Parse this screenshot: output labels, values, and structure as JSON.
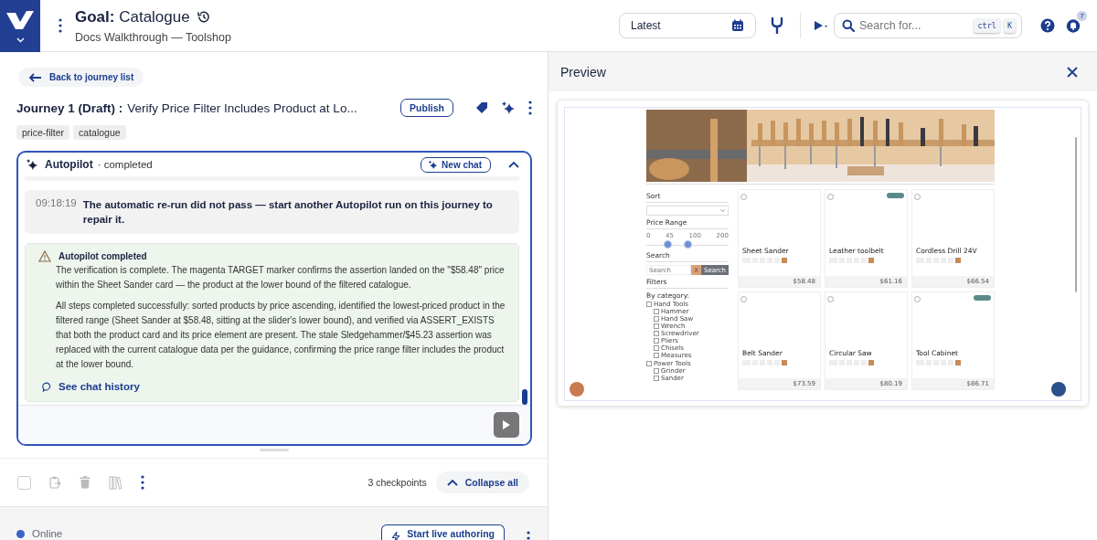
{
  "header": {
    "goal_label": "Goal:",
    "goal_name": "Catalogue",
    "subtitle": "Docs Walkthrough — Toolshop",
    "version": "Latest",
    "search_placeholder": "Search for...",
    "shortcut_keys": [
      "ctrl",
      "K"
    ],
    "notification_count": "7"
  },
  "journey": {
    "back": "Back to journey list",
    "label": "Journey 1 (Draft) :",
    "title": "Verify Price Filter Includes Product at Lo...",
    "publish": "Publish",
    "tags": [
      "price-filter",
      "catalogue"
    ]
  },
  "autopilot": {
    "title": "Autopilot",
    "status": "· completed",
    "new_chat": "New chat",
    "messages": [
      {
        "time": "09:18:19",
        "text": "The automatic re-run did not pass — start another Autopilot run on this journey to repair it."
      }
    ],
    "result": {
      "title": "Autopilot completed",
      "paragraphs": [
        "The verification is complete. The magenta TARGET marker confirms the assertion landed on the \"$58.48\" price within the Sheet Sander card — the product at the lower bound of the filtered catalogue.",
        "All steps completed successfully: sorted products by price ascending, identified the lowest-priced product in the filtered range (Sheet Sander at $58.48, sitting at the slider's lower bound), and verified via ASSERT_EXISTS that both the product card and its price element are present. The stale Sledgehammer/$45.23 assertion was replaced with the current catalogue data per the guidance, confirming the price range filter includes the product at the lower bound."
      ],
      "link": "See chat history"
    }
  },
  "toolbar": {
    "checked": false,
    "checkpoints": "3 checkpoints",
    "collapse": "Collapse all"
  },
  "status_bar": {
    "status": "Online",
    "start": "Start live authoring"
  },
  "preview": {
    "title": "Preview",
    "site": {
      "sort_label": "Sort",
      "price_label": "Price Range",
      "price_ticks": [
        "0",
        "45",
        "100",
        "200"
      ],
      "thumbs": [
        {
          "level": 0.27
        },
        {
          "level": 0.51
        }
      ],
      "search_label": "Search",
      "search_placeholder": "Search",
      "clear": "X",
      "search_button": "Search",
      "filters_label": "Filters",
      "category_label": "By category:",
      "categories": [
        {
          "name": "Hand Tools",
          "checked": false,
          "children": [
            {
              "name": "Hammer",
              "checked": false
            },
            {
              "name": "Hand Saw",
              "checked": false
            },
            {
              "name": "Wrench",
              "checked": false
            },
            {
              "name": "Screwdriver",
              "checked": false
            },
            {
              "name": "Pliers",
              "checked": false
            },
            {
              "name": "Chisels",
              "checked": false
            },
            {
              "name": "Measures",
              "checked": false
            }
          ]
        },
        {
          "name": "Power Tools",
          "checked": false,
          "children": [
            {
              "name": "Grinder",
              "checked": false
            },
            {
              "name": "Sander",
              "checked": false
            }
          ]
        }
      ],
      "products": [
        {
          "name": "Sheet Sander",
          "price": "$58.48",
          "badge": false
        },
        {
          "name": "Leather toolbelt",
          "price": "$61.16",
          "badge": true
        },
        {
          "name": "Cordless Drill 24V",
          "price": "$66.54",
          "badge": false
        },
        {
          "name": "Belt Sander",
          "price": "$73.59",
          "badge": false
        },
        {
          "name": "Circular Saw",
          "price": "$80.19",
          "badge": false
        },
        {
          "name": "Tool Cabinet",
          "price": "$86.71",
          "badge": true
        }
      ]
    }
  }
}
